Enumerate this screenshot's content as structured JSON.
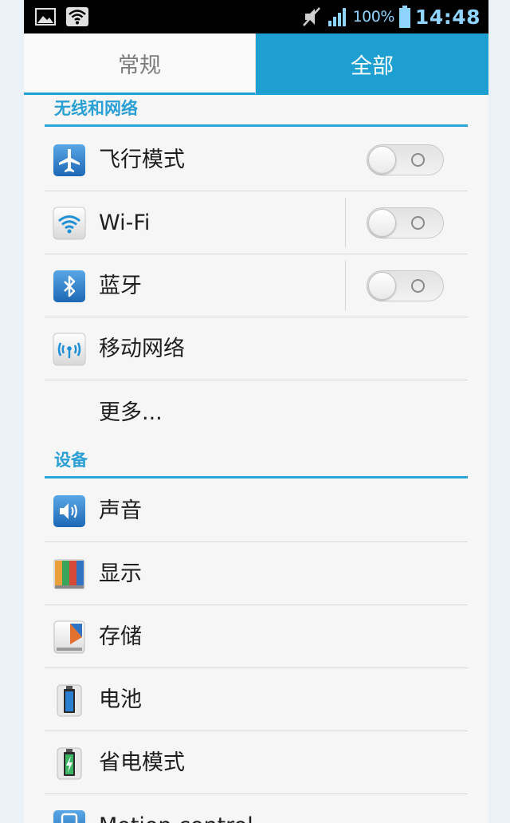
{
  "status_bar": {
    "battery_percent": "100%",
    "time": "14:48",
    "colors": {
      "background": "#000000",
      "text": "#8fd3ff"
    }
  },
  "tabs": [
    {
      "label": "常规",
      "selected": false
    },
    {
      "label": "全部",
      "selected": true
    }
  ],
  "sections": {
    "wireless": {
      "title": "无线和网络",
      "items": {
        "airplane": {
          "label": "飞行模式",
          "icon": "airplane-icon",
          "toggle": "off"
        },
        "wifi": {
          "label": "Wi-Fi",
          "icon": "wifi-icon",
          "toggle": "off"
        },
        "bluetooth": {
          "label": "蓝牙",
          "icon": "bluetooth-icon",
          "toggle": "off"
        },
        "mobile": {
          "label": "移动网络",
          "icon": "antenna-icon"
        },
        "more": {
          "label": "更多..."
        }
      }
    },
    "device": {
      "title": "设备",
      "items": {
        "sound": {
          "label": "声音",
          "icon": "speaker-icon"
        },
        "display": {
          "label": "显示",
          "icon": "display-icon"
        },
        "storage": {
          "label": "存储",
          "icon": "storage-icon"
        },
        "battery": {
          "label": "电池",
          "icon": "battery-icon"
        },
        "power_saving": {
          "label": "省电模式",
          "icon": "power-saving-icon"
        },
        "motion": {
          "label": "Motion control",
          "icon": "motion-icon"
        }
      }
    }
  },
  "accent_color": "#1d9fd1"
}
